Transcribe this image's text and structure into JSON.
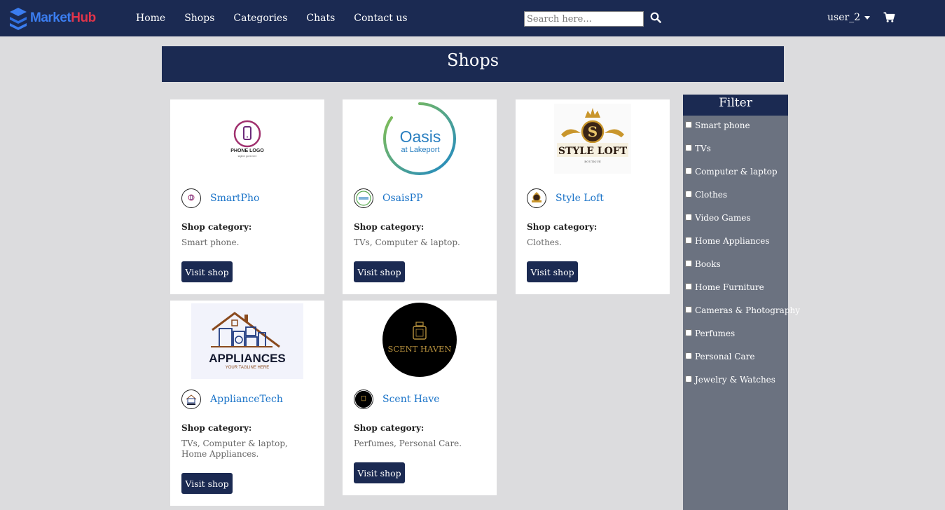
{
  "brand": {
    "name_part1": "Market",
    "name_part2": "Hub",
    "accent": "#3b7df0",
    "accent2": "#e0344a"
  },
  "nav": {
    "links": [
      "Home",
      "Shops",
      "Categories",
      "Chats",
      "Contact us"
    ]
  },
  "search": {
    "placeholder": "Search here...",
    "icon": "search-icon"
  },
  "user": {
    "name": "user_2",
    "icon": "chevron-down-icon"
  },
  "cart": {
    "icon": "cart-icon"
  },
  "page": {
    "title": "Shops",
    "header_color": "#1b2a52"
  },
  "shops": [
    {
      "name": "SmartPho",
      "category_label": "Shop category:",
      "category": "Smart phone.",
      "button": "Visit shop",
      "logo_text": "PHONE LOGO",
      "logo_tagline": "tagline goes here"
    },
    {
      "name": "OsaisPP",
      "category_label": "Shop category:",
      "category": "TVs, Computer & laptop.",
      "button": "Visit shop",
      "logo_text": "Oasis",
      "logo_sub": "at Lakeport"
    },
    {
      "name": "Style Loft",
      "category_label": "Shop category:",
      "category": "Clothes.",
      "button": "Visit shop",
      "logo_text": "STYLE LOFT",
      "logo_letter": "S",
      "logo_sub": "BOUTIQUE"
    },
    {
      "name": "ApplianceTech",
      "category_label": "Shop category:",
      "category": "TVs, Computer & laptop, Home Appliances.",
      "button": "Visit shop",
      "logo_text": "APPLIANCES",
      "logo_tagline": "YOUR TAGLINE HERE"
    },
    {
      "name": "Scent Have",
      "category_label": "Shop category:",
      "category": "Perfumes, Personal Care.",
      "button": "Visit shop",
      "logo_text": "SCENT HAVEN"
    }
  ],
  "filter": {
    "title": "Filter",
    "options": [
      "Smart phone",
      "TVs",
      "Computer & laptop",
      "Clothes",
      "Video Games",
      "Home Appliances",
      "Books",
      "Home Furniture",
      "Cameras & Photography",
      "Perfumes",
      "Personal Care",
      "Jewelry & Watches"
    ]
  }
}
